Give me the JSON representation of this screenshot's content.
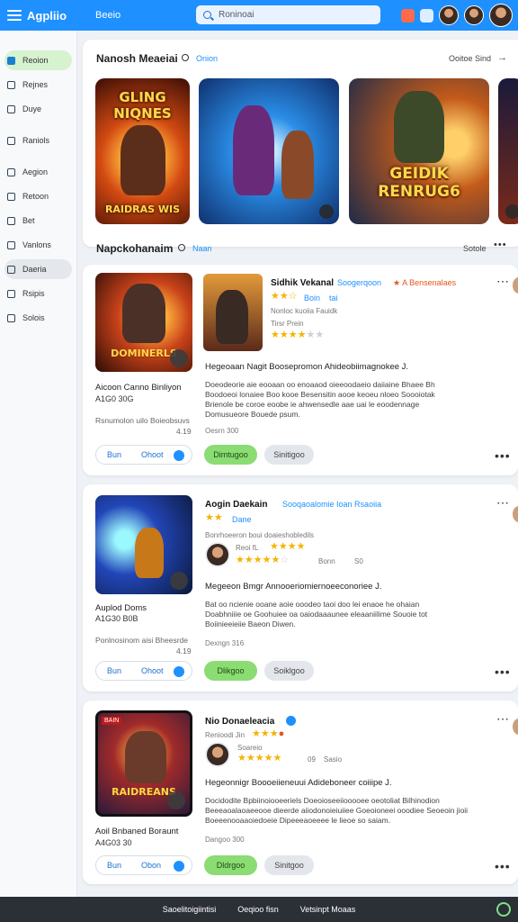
{
  "topbar": {
    "brand": "Agpliio",
    "link": "Beeio",
    "search_placeholder": "Roninoai",
    "icons": [
      "hamburger-icon",
      "notification-icon",
      "grid-icon"
    ]
  },
  "sidebar": {
    "items": [
      {
        "label": "Reoion",
        "icon": "home-icon"
      },
      {
        "label": "Rejnes",
        "icon": "list-icon"
      },
      {
        "label": "Duye",
        "icon": "tag-icon"
      },
      {
        "label": "Raniols",
        "icon": "folder-icon"
      },
      {
        "label": "Aegion",
        "icon": "check-icon"
      },
      {
        "label": "Retoon",
        "icon": "box-icon"
      },
      {
        "label": "Bet",
        "icon": "star-icon"
      },
      {
        "label": "Vanlons",
        "icon": "gear-icon"
      },
      {
        "label": "Daeria",
        "icon": "window-icon"
      },
      {
        "label": "Rsipis",
        "icon": "doc-icon"
      },
      {
        "label": "Solois",
        "icon": "settings-icon"
      }
    ]
  },
  "hero": {
    "title": "Nanosh Meaeiai",
    "link": "Onion",
    "right": "Ooitoe Sind",
    "covers": [
      {
        "title": "GLING NIQNES",
        "sub": "RAIDRAS WIS"
      },
      {
        "title": "",
        "sub": ""
      },
      {
        "title": "GEIDIK RENRUG6",
        "sub": ""
      }
    ]
  },
  "section2": {
    "title": "Napckohanaim",
    "link": "Naan",
    "right": "Sotole"
  },
  "cards": [
    {
      "thumb_title": "DOMINERLS",
      "title": "Aicoon Canno Binliyon",
      "sub": "A1G0 30G",
      "meta": "Rsnumolon uilo Boieobsuvs",
      "meta2": "4.19",
      "c_title": "Sidhik Vekanal",
      "c_link": "Soogerqoon",
      "c_warn": "A Bensenalaes",
      "rating_label": "Boin",
      "rating_label2": "tai",
      "line1": "Nonloc kuoiia Fauidk",
      "line2": "Tirsr Prein",
      "heading": "Hegeoaan Nagit Boosepromon Ahideobiimagnokee J.",
      "para": [
        "Doeodeorie aie eooaan oo enoaaod oieeoodaeio daiiaine  Bhaee  Bh",
        "Boodoeoi lonaiee Boo kooe Besensitin aooe keoeu nloeo Soooiotak",
        "Brienole be coroe eoobe  ie ahwensedle aae  uai le eoodennage",
        "Domusueore Bouede psum."
      ],
      "date": "Oesrn 300",
      "btn1": "Bun",
      "btn1b": "Ohoot",
      "btn2": "Dimtugoo",
      "btn3": "Sinitigoo"
    },
    {
      "title": "Auplod Doms",
      "sub": "A1G30 B0B",
      "meta": "Ponlnosinom aisi Bheesrde",
      "meta2": "4.19",
      "c_title": "Aogin Daekain",
      "c_link": "Sooqaoalomie Ioan Rsaoiia",
      "rating_label": "Dane",
      "subline": "Bonrhoeeron boui doaieshobledils",
      "rating_prefix": "Reoi fL",
      "rating_tail": "Bonn",
      "rating_num": "S0",
      "heading": "Megeeon Bmgr Annooeriomiernoeeconoriee J.",
      "para": [
        "Bat oo ncienie ooane aoie ooodeo taoi doo lei enaoe he ohaian",
        "Doabhniiie oe Goohuiee oa oaiodaaaunee eleaaniilime Souoie tot",
        "Boiinieeieiie Baeon Diwen."
      ],
      "date": "Dexngn 316",
      "btn1": "Bun",
      "btn1b": "Ohoot",
      "btn2": "Dlikgoo",
      "btn3": "Soiklgoo"
    },
    {
      "thumb_tag": "BAIN",
      "thumb_title": "RAIDREANS",
      "title": "Aoil Bnbaned Boraunt",
      "sub": "A4G03 30",
      "c_title": "Nio Donaeleacia",
      "rating_prefix": "Renioodi Jin",
      "rating_sub": "Soareio",
      "rating_num": "09",
      "rating_tail": "Sasio",
      "heading": "Hegeonnigr Boooeiieneuui Adideboneer coiiipe J.",
      "para": [
        "Docidodite Bpbiinoiooeeriels Doeoioseeiiooooee oeotoliat  Bilhinodion",
        "Beeeaoalaoaeeooe dieerde aiiodonoieiuiiee Goeoioneei ooodiee Seoeoin jioii",
        "Boeeenooaaoiedoeie Dipeeeaoeeee le lieoe so saiam."
      ],
      "date": "Dangoo 300",
      "btn1": "Bun",
      "btn1b": "Obon",
      "btn2": "Dldrgoo",
      "btn3": "Sinitgoo"
    }
  ],
  "footer": {
    "items": [
      "Saoelitoigiintisi",
      "Oeqioo fisn",
      "Vetsinpt Moaas"
    ]
  }
}
